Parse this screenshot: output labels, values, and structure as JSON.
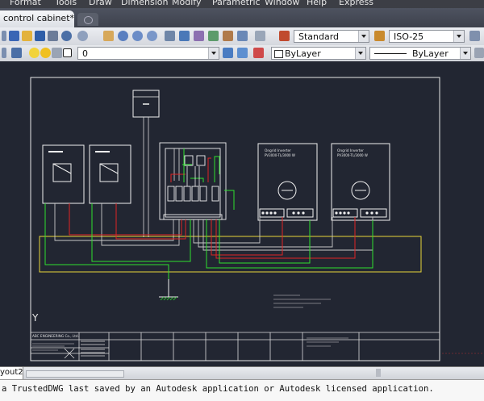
{
  "menu": [
    "Format",
    "Tools",
    "Draw",
    "Dimension",
    "Modify",
    "Parametric",
    "Window",
    "Help",
    "Express"
  ],
  "document_tab": "control cabinet*",
  "toolbar": {
    "text_style": "Standard",
    "dim_style": "ISO-25",
    "layer": "0",
    "color": "ByLayer",
    "linetype": "ByLayer"
  },
  "drawing": {
    "title_company": "ABC ENGINEERING Co., Ltd.",
    "inverter_title": "Ongrid Inverter",
    "inverter_model": "PV3000-TL/3000 W",
    "axis_label": "Y"
  },
  "layout_tab": "yout2",
  "command_line": "a TrustedDWG last saved by an Autodesk application or Autodesk licensed application."
}
